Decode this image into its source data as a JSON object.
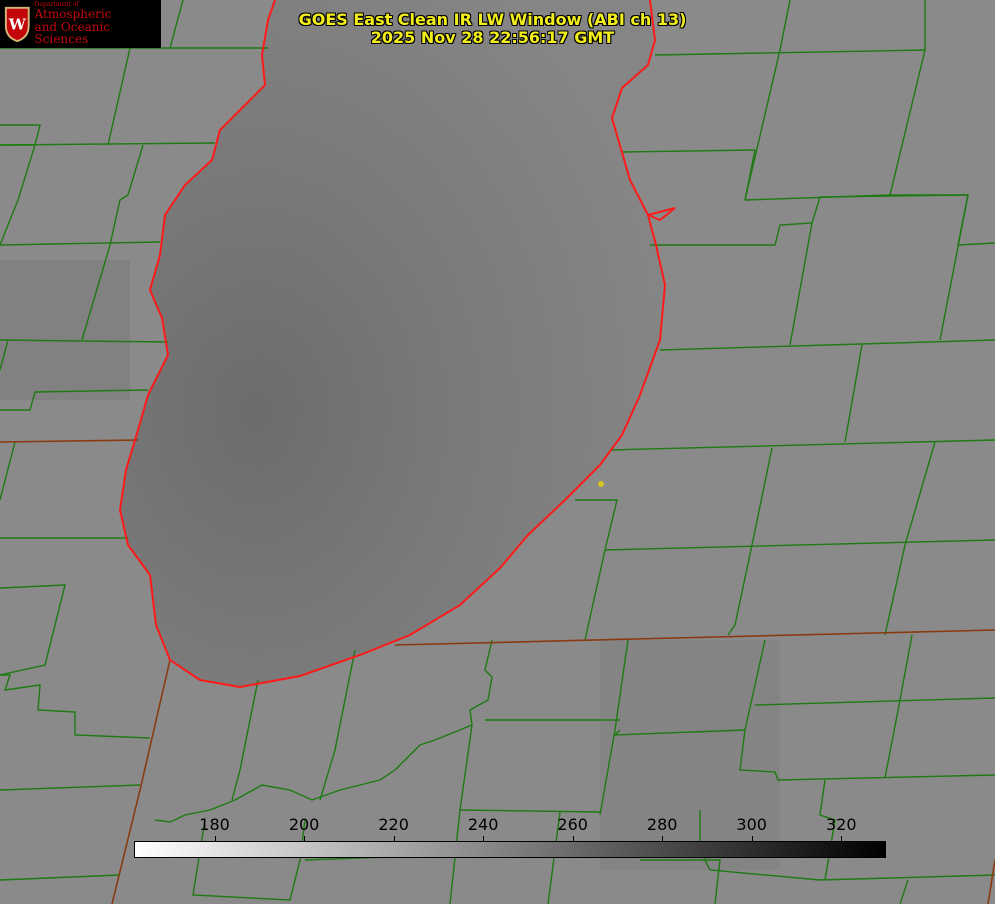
{
  "title": {
    "line1": "GOES East Clean IR LW Window (ABI ch 13)",
    "line2": "2025 Nov 28 22:56:17 GMT"
  },
  "logo": {
    "department": "Department of",
    "line1": "Atmospheric",
    "line2": "and Oceanic Sciences",
    "crest_letter": "W"
  },
  "colorbar": {
    "ticks": [
      "180",
      "200",
      "220",
      "240",
      "260",
      "280",
      "300",
      "320"
    ],
    "range": [
      162,
      330
    ],
    "start_color": "#ffffff",
    "end_color": "#000000"
  },
  "colors": {
    "county_lines": "#1e7a12",
    "state_lines": "#8a3a10",
    "coastline": "#ff1a1a",
    "title_text": "#f2ee1c",
    "marker": "#d4c520"
  }
}
